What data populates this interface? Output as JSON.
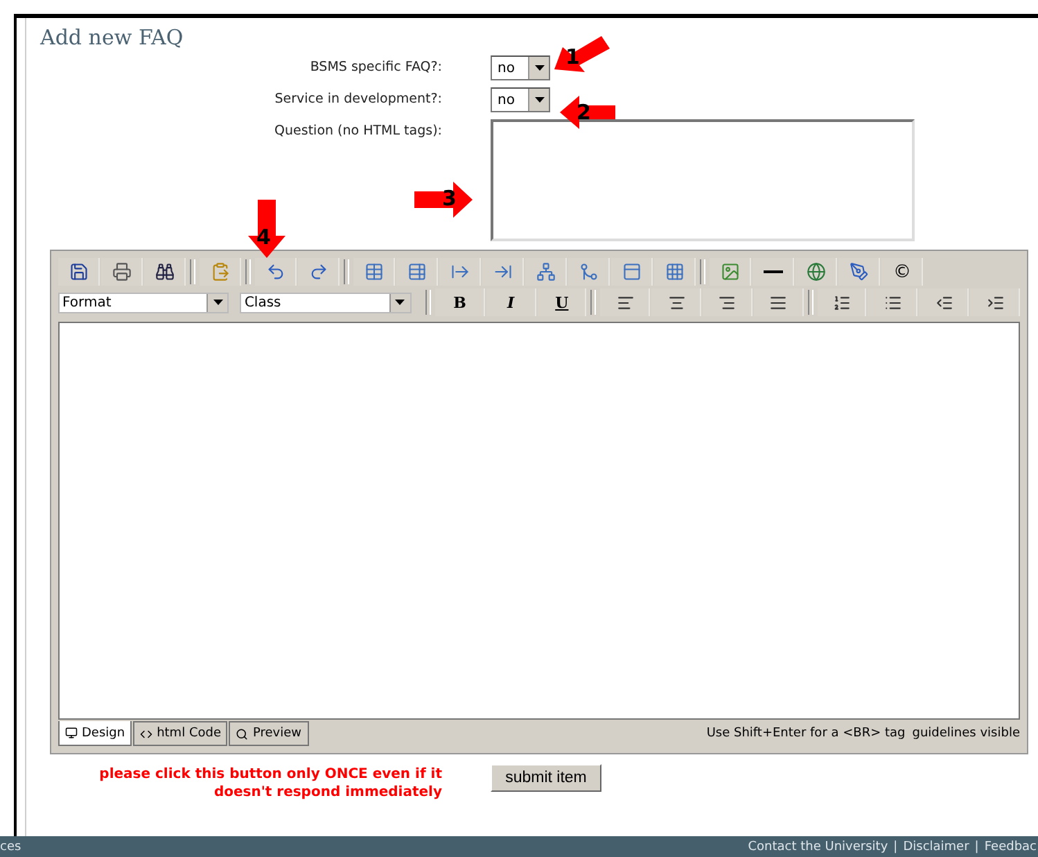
{
  "page": {
    "title": "Add new FAQ"
  },
  "fields": [
    {
      "kind": "select",
      "label": "BSMS specific FAQ?:",
      "value": "no"
    },
    {
      "kind": "select",
      "label": "Service in development?:",
      "value": "no"
    },
    {
      "kind": "textarea",
      "label": "Question (no HTML tags):"
    }
  ],
  "annotations": [
    {
      "kind": "down-left",
      "number": "1"
    },
    {
      "kind": "left",
      "number": "2"
    },
    {
      "kind": "right",
      "number": "3"
    },
    {
      "kind": "down",
      "number": "4"
    }
  ],
  "editor": {
    "format_placeholder": "Format",
    "class_placeholder": "Class",
    "style_buttons": [
      "B",
      "I",
      "U"
    ],
    "copyright_button": "©",
    "tabs": [
      {
        "kind": "design",
        "label": "Design",
        "selected": true
      },
      {
        "kind": "code",
        "label": "html Code",
        "selected": false
      },
      {
        "kind": "preview",
        "label": "Preview",
        "selected": false
      }
    ],
    "hint": "Use Shift+Enter for a <BR> tag",
    "guidelines": "guidelines visible"
  },
  "warning": [
    "please click this button only ONCE even if it",
    "doesn't respond immediately"
  ],
  "submit": "submit item",
  "footer": {
    "left": "ces",
    "separator": "|",
    "links": [
      "Contact the University",
      "Disclaimer",
      "Feedbac"
    ]
  }
}
